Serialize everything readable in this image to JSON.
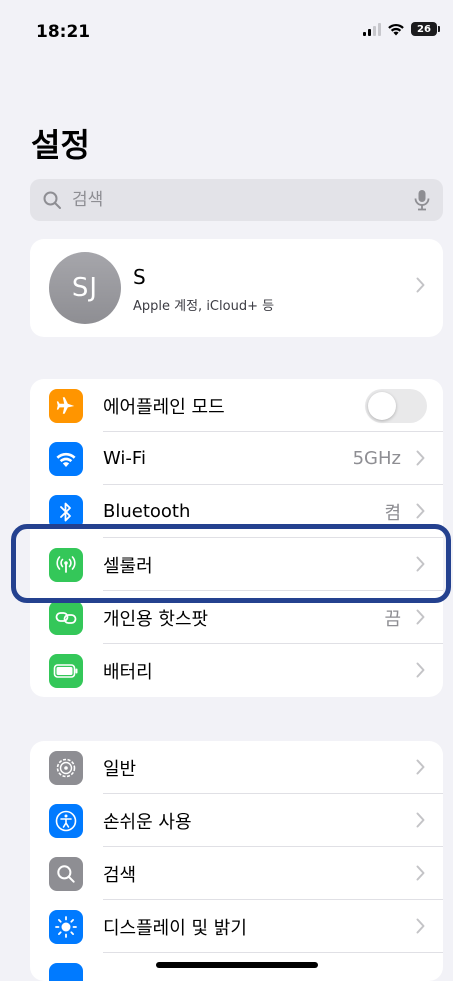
{
  "status_bar": {
    "time": "18:21",
    "battery": "26"
  },
  "page_title": "설정",
  "search": {
    "placeholder": "검색"
  },
  "profile": {
    "initials": "SJ",
    "name": "S",
    "subtitle": "Apple 계정, iCloud+ 등"
  },
  "connectivity": [
    {
      "label": "에어플레인 모드",
      "value": "",
      "icon": "airplane-icon",
      "color": "#ff9500",
      "toggle": true,
      "toggle_on": false
    },
    {
      "label": "Wi-Fi",
      "value": "5GHz",
      "icon": "wifi-icon",
      "color": "#007aff"
    },
    {
      "label": "Bluetooth",
      "value": "켬",
      "icon": "bluetooth-icon",
      "color": "#007aff"
    },
    {
      "label": "셀룰러",
      "value": "",
      "icon": "cellular-antenna-icon",
      "color": "#34c759"
    },
    {
      "label": "개인용 핫스팟",
      "value": "끔",
      "icon": "hotspot-link-icon",
      "color": "#34c759"
    },
    {
      "label": "배터리",
      "value": "",
      "icon": "battery-icon",
      "color": "#34c759"
    }
  ],
  "general": [
    {
      "label": "일반",
      "value": "",
      "icon": "gear-icon",
      "color": "#8e8e93"
    },
    {
      "label": "손쉬운 사용",
      "value": "",
      "icon": "accessibility-icon",
      "color": "#007aff"
    },
    {
      "label": "검색",
      "value": "",
      "icon": "search-icon",
      "color": "#8e8e93"
    },
    {
      "label": "디스플레이 및 밝기",
      "value": "",
      "icon": "brightness-sun-icon",
      "color": "#007aff"
    }
  ],
  "highlight_color": "#24418f"
}
